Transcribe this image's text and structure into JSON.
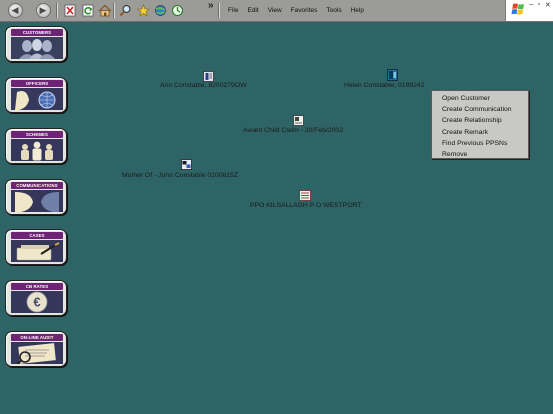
{
  "toolbar": {
    "buttons": [
      "back-icon",
      "forward-icon",
      "stop-icon",
      "refresh-icon",
      "home-icon",
      "search-icon",
      "favorites-icon",
      "media-icon",
      "history-icon"
    ],
    "overflow_glyph": "»"
  },
  "menubar": {
    "items": [
      "File",
      "Edit",
      "View",
      "Favorites",
      "Tools",
      "Help"
    ]
  },
  "tiles": [
    {
      "label": "CUSTOMERS",
      "icon": "customers-icon"
    },
    {
      "label": "OFFICERS",
      "icon": "officers-icon"
    },
    {
      "label": "SCHEMES",
      "icon": "schemes-icon"
    },
    {
      "label": "COMMUNICATIONS",
      "icon": "communications-icon"
    },
    {
      "label": "CASES",
      "icon": "cases-icon"
    },
    {
      "label": "CB RATES",
      "icon": "cb-rates-icon"
    },
    {
      "label": "ON-LINE AUDIT",
      "icon": "online-audit-icon"
    }
  ],
  "entities": {
    "ann": {
      "label": "Ann Constable, 8200279OW",
      "icon": "person-card-icon"
    },
    "helen": {
      "label": "Helen Constable, 0199242",
      "icon": "person-card-icon"
    },
    "award": {
      "label": "Award Child Claim - 20/Feb/2002",
      "icon": "claim-document-icon"
    },
    "mother": {
      "label": "Mother Of - John Constable 0200815Z",
      "icon": "relationship-icon"
    },
    "ppo": {
      "label": "PPO KILSALLAGH P O WESTPORT",
      "icon": "post-office-icon"
    }
  },
  "context_menu": {
    "items": [
      "Open Customer",
      "Create Communication",
      "Create Relationship",
      "Create Remark",
      "Find Previous PPSNs",
      "Remove"
    ]
  },
  "colors": {
    "canvas": "#2f6467",
    "tile_header": "#6d2474",
    "toolbar": "#9b9b98",
    "menu": "#c8c8c5"
  }
}
